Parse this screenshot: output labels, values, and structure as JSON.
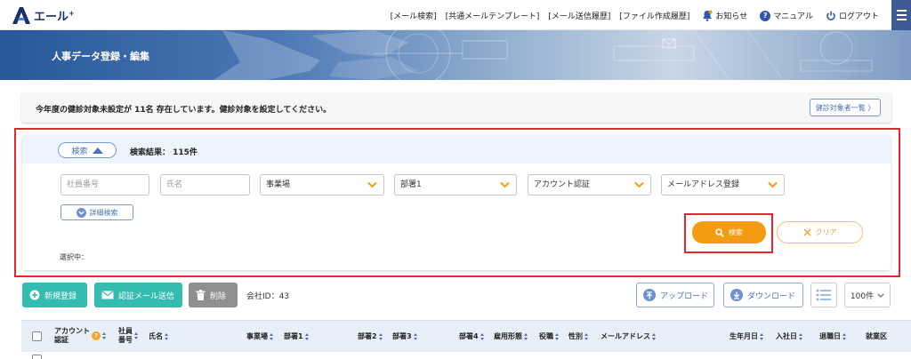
{
  "app": {
    "logo_text": "エール",
    "logo_sup": "+"
  },
  "nav": {
    "links": [
      "[メール検索]",
      "[共通メールテンプレート]",
      "[メール送信履歴]",
      "[ファイル作成履歴]"
    ],
    "notice_label": "お知らせ",
    "manual_label": "マニュアル",
    "logout_label": "ログアウト",
    "manual_glyph": "?"
  },
  "banner": {
    "title": "人事データ登録・編集"
  },
  "notice": {
    "text": "今年度の健診対象未設定が 11名 存在しています。健診対象を設定してください。",
    "button": "健診対象者一覧 〉"
  },
  "search": {
    "toggle_label": "検索",
    "result_text": "検索結果： 115件",
    "employee_no_placeholder": "社員番号",
    "name_placeholder": "氏名",
    "office_select": "事業場",
    "dept_select": "部署1",
    "account_select": "アカウント認証",
    "email_select": "メールアドレス登録",
    "detail_label": "詳細検索",
    "search_label": "検索",
    "clear_label": "クリア",
    "selected_label": "選択中："
  },
  "toolbar": {
    "new_label": "新規登録",
    "auth_mail_label": "認証メール送信",
    "delete_label": "削除",
    "company_id": "会社ID：43",
    "upload_label": "アップロード",
    "download_label": "ダウンロード",
    "per_page": "100件"
  },
  "table": {
    "account_line1": "アカウント",
    "account_line2": "認証",
    "empno_line1": "社員",
    "empno_line2": "番号",
    "headers": [
      "氏名",
      "事業場",
      "部署1",
      "部署2",
      "部署3",
      "部署4",
      "雇用形態",
      "役職",
      "性別",
      "メールアドレス",
      "生年月日",
      "入社日",
      "退職日",
      "就業区"
    ]
  },
  "colors": {
    "accent": "#f39c12",
    "teal": "#33bcaf",
    "link_blue": "#4a70b8",
    "highlight": "#e2262b",
    "navy": "#1a2e6b"
  }
}
